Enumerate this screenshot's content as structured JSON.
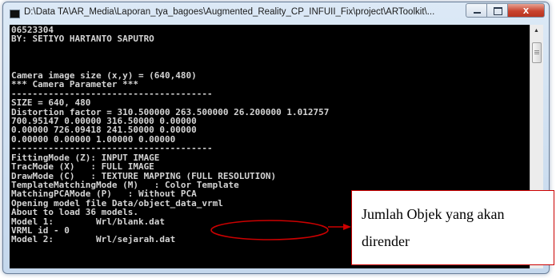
{
  "window": {
    "title": "D:\\Data TA\\AR_Media\\Laporan_tya_bagoes\\Augmented_Reality_CP_INFUII_Fix\\project\\ARToolkit\\...",
    "close_label": "x"
  },
  "console": {
    "lines": [
      "06523304",
      "BY: SETIYO HARTANTO SAPUTRO",
      "",
      "",
      "",
      "Camera image size (x,y) = (640,480)",
      "*** Camera Parameter ***",
      "--------------------------------------",
      "SIZE = 640, 480",
      "Distortion factor = 310.500000 263.500000 26.200000 1.012757",
      "700.95147 0.00000 316.50000 0.00000",
      "0.00000 726.09418 241.50000 0.00000",
      "0.00000 0.00000 1.00000 0.00000",
      "--------------------------------------",
      "FittingMode (Z): INPUT IMAGE",
      "TracMode (X)   : FULL IMAGE",
      "DrawMode (C)   : TEXTURE MAPPING (FULL RESOLUTION)",
      "TemplateMatchingMode (M)   : Color Template",
      "MatchingPCAMode (P)   : Without PCA",
      "Opening model file Data/object_data_vrml",
      "About to load 36 models.",
      "Model 1:        Wrl/blank.dat",
      "VRML id - 0",
      "Model 2:        Wrl/sejarah.dat"
    ]
  },
  "annotation": {
    "text_line1": "Jumlah Objek yang akan",
    "text_line2": "dirender",
    "color": "#cc0000"
  }
}
